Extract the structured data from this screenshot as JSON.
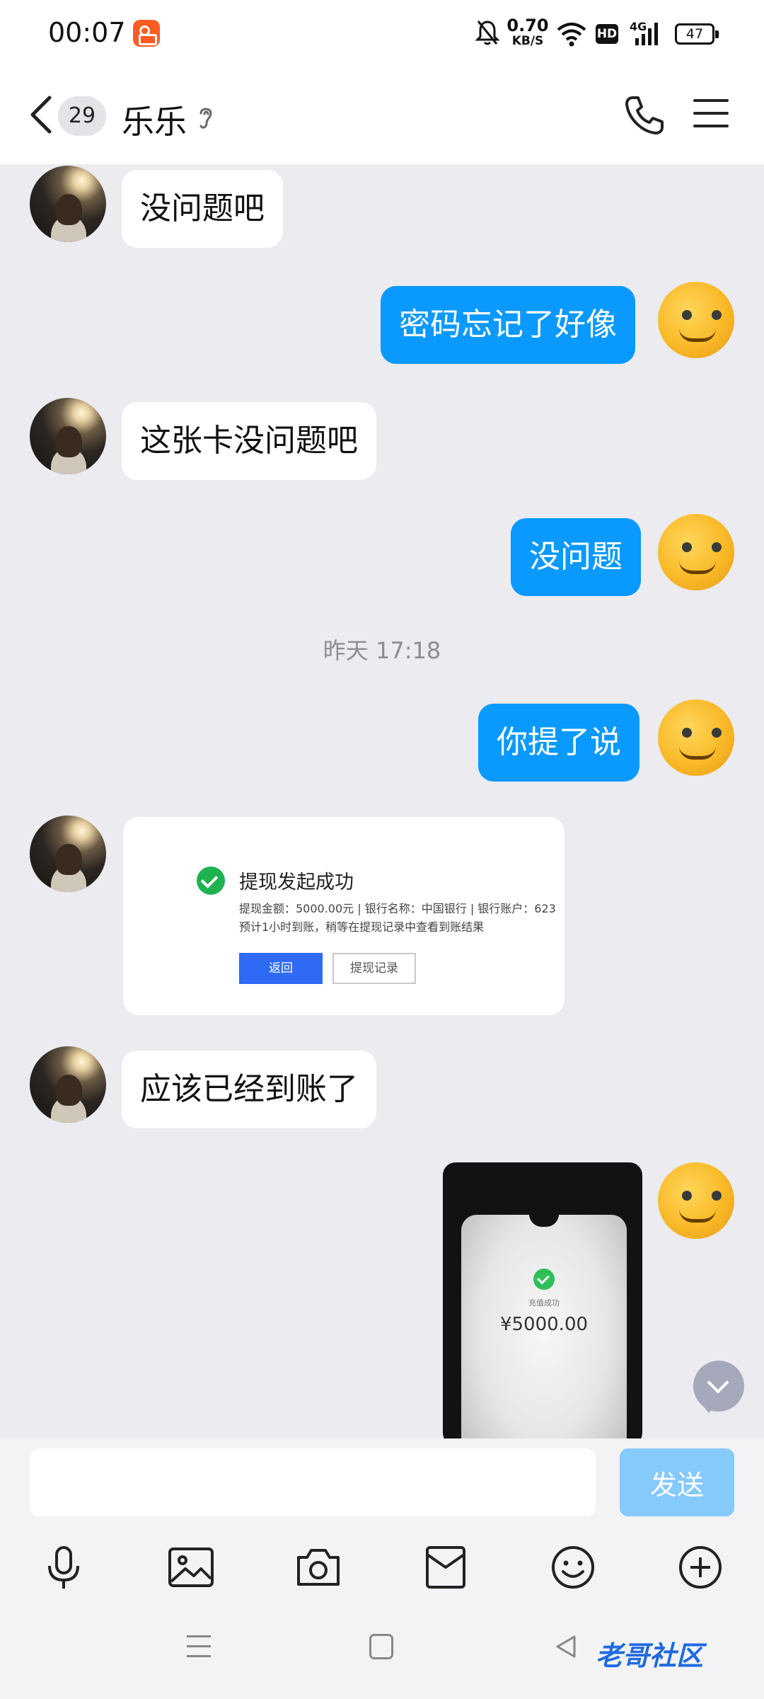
{
  "status_bar": {
    "time": "00:07",
    "net_speed_value": "0.70",
    "net_speed_unit": "KB/S",
    "hd": "HD",
    "signal": "4G",
    "battery": "47"
  },
  "header": {
    "unread_count": "29",
    "title": "乐乐"
  },
  "messages": [
    {
      "side": "in",
      "text": "没问题吧"
    },
    {
      "side": "out",
      "text": "密码忘记了好像"
    },
    {
      "side": "in",
      "text": "这张卡没问题吧"
    },
    {
      "side": "out",
      "text": "没问题"
    },
    {
      "side": "time",
      "text": "昨天 17:18"
    },
    {
      "side": "out",
      "text": "你提了说"
    },
    {
      "side": "in",
      "text": "应该已经到账了"
    }
  ],
  "withdraw_card": {
    "title": "提现发起成功",
    "line1": "提现金额：5000.00元  |  银行名称：中国银行  |  银行账户：623",
    "line2": "预计1小时到账，稍等在提现记录中查看到账结果",
    "primary_button": "返回",
    "secondary_button": "提现记录"
  },
  "photo_message": {
    "label": "充值成功",
    "amount": "¥5000.00"
  },
  "input": {
    "placeholder": "",
    "send_label": "发送"
  },
  "watermark": "老哥社区",
  "colors": {
    "outgoing_bubble": "#0a99ff",
    "send_button": "#86c9fb",
    "background": "#ebebf0"
  }
}
